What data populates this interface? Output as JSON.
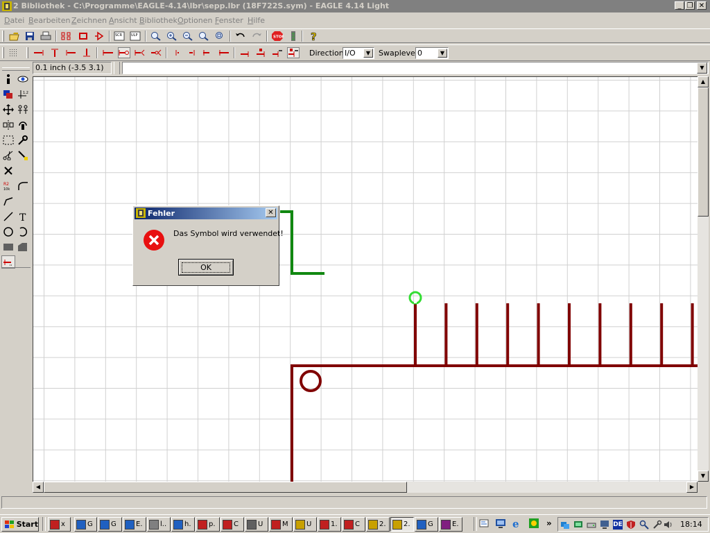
{
  "window": {
    "title": "2 Bibliothek - C:\\Programme\\EAGLE-4.14\\lbr\\sepp.lbr (18F722S.sym) - EAGLE 4.14 Light",
    "minimize_glyph": "_",
    "restore_glyph": "❐",
    "close_glyph": "✕"
  },
  "menu": {
    "items": [
      "Datei",
      "Bearbeiten",
      "Zeichnen",
      "Ansicht",
      "Bibliothek",
      "Optionen",
      "Fenster",
      "Hilfe"
    ],
    "accel": [
      "D",
      "B",
      "Z",
      "A",
      "B",
      "O",
      "F",
      "H"
    ]
  },
  "toolbar2": {
    "direction_label": "Direction:",
    "direction_value": "I/O",
    "swaplevel_label": "Swaplevel:",
    "swaplevel_value": "0"
  },
  "coord": {
    "grid_readout": "0.1 inch (-3.5 3.1)",
    "command_value": ""
  },
  "dialog": {
    "title": "Fehler",
    "message": "Das Symbol wird verwendet!",
    "ok_label": "OK",
    "close_glyph": "✕",
    "error_glyph": "✕"
  },
  "taskbar": {
    "start_label": "Start",
    "tasks": [
      "x",
      "G",
      "G",
      "E.",
      "l..",
      "h.",
      "p.",
      "C",
      "U",
      "M",
      "U",
      "1.",
      "C",
      "2.",
      "2.",
      "G",
      "E."
    ],
    "chevron": "»",
    "clock": "18:14",
    "lang": "DE"
  },
  "colors": {
    "pin_green": "#118811",
    "pin_red": "#800000",
    "grid": "#d0d0d0",
    "origin_circle": "#33dd33",
    "error_red": "#e81010"
  }
}
